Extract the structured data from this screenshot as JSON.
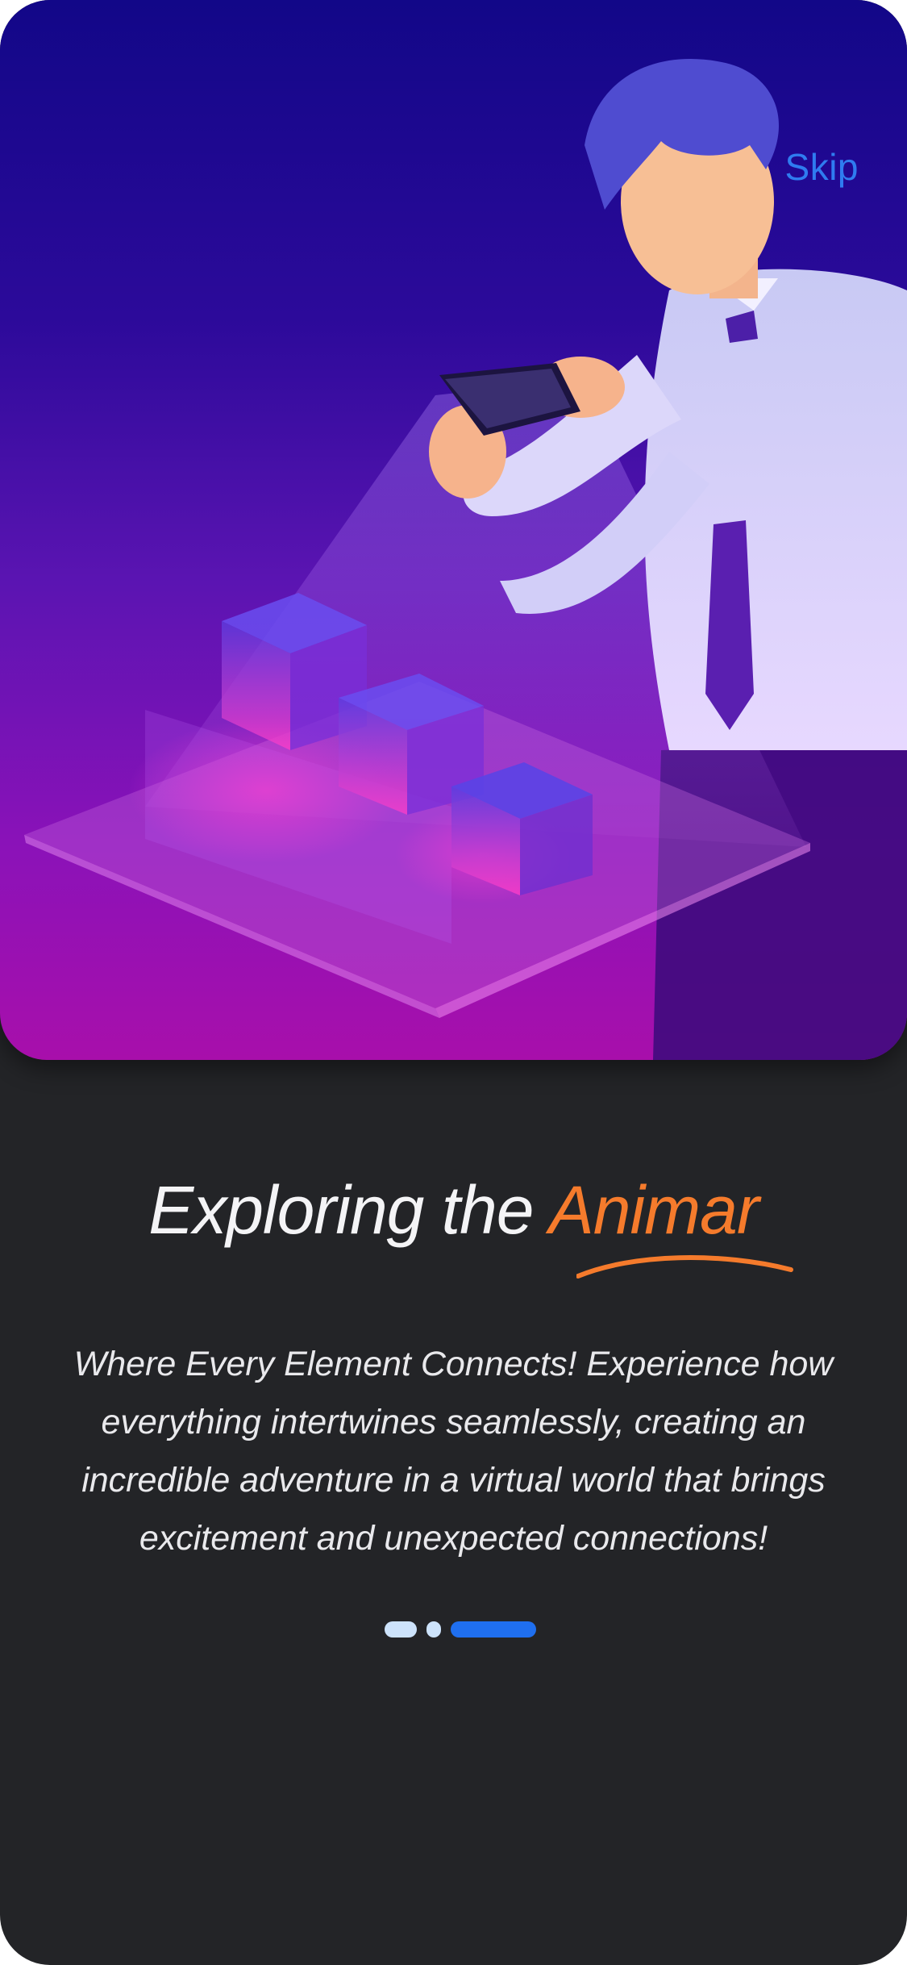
{
  "header": {
    "skip_label": "Skip"
  },
  "onboarding": {
    "title_main": "Exploring the",
    "title_accent": "Animar",
    "description": "Where Every Element Connects! Experience how everything intertwines seamlessly, creating an incredible adventure in a virtual world that brings excitement and unexpected connections!",
    "pager": {
      "page_count": 3,
      "active_index": 2
    }
  },
  "colors": {
    "background": "#232427",
    "accent": "#f57b2c",
    "skip": "#2f7cf0",
    "dot_active": "#1f6fef",
    "dot_inactive": "#cde3fb"
  },
  "icons": {
    "hero": "man-with-phone-projecting-3d-city-illustration"
  }
}
